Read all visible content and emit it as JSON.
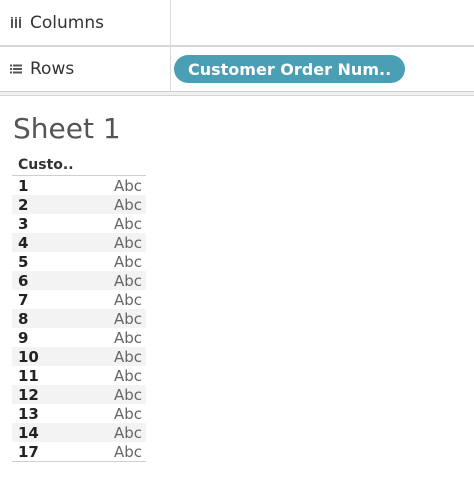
{
  "shelves": {
    "columns": {
      "label": "Columns",
      "icon": "columns-icon"
    },
    "rows": {
      "label": "Rows",
      "icon": "rows-icon",
      "pill": "Customer Order Num.."
    }
  },
  "sheet": {
    "title": "Sheet 1"
  },
  "table": {
    "header": "Custo..",
    "rows": [
      {
        "num": "1",
        "val": "Abc"
      },
      {
        "num": "2",
        "val": "Abc"
      },
      {
        "num": "3",
        "val": "Abc"
      },
      {
        "num": "4",
        "val": "Abc"
      },
      {
        "num": "5",
        "val": "Abc"
      },
      {
        "num": "6",
        "val": "Abc"
      },
      {
        "num": "7",
        "val": "Abc"
      },
      {
        "num": "8",
        "val": "Abc"
      },
      {
        "num": "9",
        "val": "Abc"
      },
      {
        "num": "10",
        "val": "Abc"
      },
      {
        "num": "11",
        "val": "Abc"
      },
      {
        "num": "12",
        "val": "Abc"
      },
      {
        "num": "13",
        "val": "Abc"
      },
      {
        "num": "14",
        "val": "Abc"
      },
      {
        "num": "17",
        "val": "Abc"
      }
    ]
  },
  "colors": {
    "pill": "#4a9fb5"
  }
}
